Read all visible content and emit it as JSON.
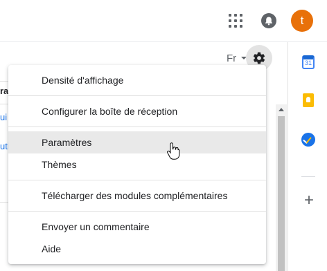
{
  "header": {
    "apps_icon": "apps-grid-icon",
    "notifications_icon": "bell-icon",
    "avatar_letter": "t",
    "avatar_color": "#e8710a"
  },
  "toolbar": {
    "language_label": "Fr",
    "settings_icon": "gear-icon"
  },
  "left_strip": {
    "fragments": [
      "ra",
      "ui",
      "uti"
    ]
  },
  "side_panel": {
    "calendar_label": "31",
    "icons": [
      "calendar-icon",
      "keep-icon",
      "tasks-icon",
      "add-icon"
    ]
  },
  "settings_menu": {
    "items": [
      {
        "label": "Densité d'affichage"
      },
      {
        "label": "Configurer la boîte de réception"
      },
      {
        "label": "Paramètres",
        "hovered": true
      },
      {
        "label": "Thèmes"
      },
      {
        "label": "Télécharger des modules complémentaires"
      },
      {
        "label": "Envoyer un commentaire"
      },
      {
        "label": "Aide"
      }
    ]
  }
}
